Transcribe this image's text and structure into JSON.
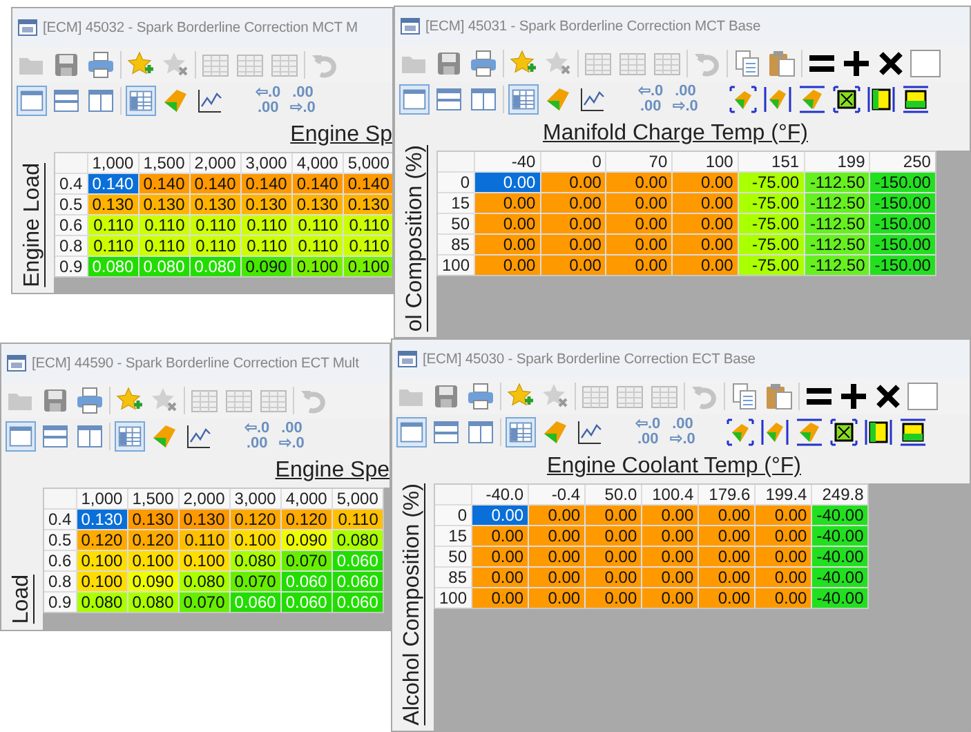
{
  "windows": [
    {
      "title": "[ECM] 45032 - Spark Borderline Correction MCT M",
      "clipped": true,
      "decimal_buttons": [
        {
          "lines": [
            "⇦.0",
            ".00"
          ]
        },
        {
          "lines": [
            ".00",
            "⇨.0"
          ]
        }
      ],
      "x_axis_label": "Engine Sp",
      "y_axis_label": "Engine Load",
      "table": {
        "columns": [
          "1,000",
          "1,500",
          "2,000",
          "3,000",
          "4,000",
          "5,000"
        ],
        "rows": [
          {
            "label": "0.4",
            "cells": [
              {
                "v": "0.140",
                "color": "#0a6fd8"
              },
              {
                "v": "0.140",
                "color": "#ff9900"
              },
              {
                "v": "0.140",
                "color": "#ff9900"
              },
              {
                "v": "0.140",
                "color": "#ff9900"
              },
              {
                "v": "0.140",
                "color": "#ff9900"
              },
              {
                "v": "0.140",
                "color": "#ff9900"
              }
            ]
          },
          {
            "label": "0.5",
            "cells": [
              {
                "v": "0.130",
                "color": "#ffb300"
              },
              {
                "v": "0.130",
                "color": "#ffb300"
              },
              {
                "v": "0.130",
                "color": "#ffb300"
              },
              {
                "v": "0.130",
                "color": "#ffb300"
              },
              {
                "v": "0.130",
                "color": "#ffb300"
              },
              {
                "v": "0.130",
                "color": "#ffb300"
              }
            ]
          },
          {
            "label": "0.6",
            "cells": [
              {
                "v": "0.110",
                "color": "#ccff00"
              },
              {
                "v": "0.110",
                "color": "#ccff00"
              },
              {
                "v": "0.110",
                "color": "#ccff00"
              },
              {
                "v": "0.110",
                "color": "#ccff00"
              },
              {
                "v": "0.110",
                "color": "#ccff00"
              },
              {
                "v": "0.110",
                "color": "#ccff00"
              }
            ]
          },
          {
            "label": "0.8",
            "cells": [
              {
                "v": "0.110",
                "color": "#ccff00"
              },
              {
                "v": "0.110",
                "color": "#ccff00"
              },
              {
                "v": "0.110",
                "color": "#ccff00"
              },
              {
                "v": "0.110",
                "color": "#ccff00"
              },
              {
                "v": "0.110",
                "color": "#ccff00"
              },
              {
                "v": "0.110",
                "color": "#ccff00"
              }
            ]
          },
          {
            "label": "0.9",
            "cells": [
              {
                "v": "0.080",
                "color": "#22dd00"
              },
              {
                "v": "0.080",
                "color": "#22dd00"
              },
              {
                "v": "0.080",
                "color": "#22dd00"
              },
              {
                "v": "0.090",
                "color": "#44e800"
              },
              {
                "v": "0.100",
                "color": "#77f000"
              },
              {
                "v": "0.100",
                "color": "#77f000"
              }
            ]
          }
        ]
      }
    },
    {
      "title": "[ECM] 45031 - Spark Borderline Correction MCT Base",
      "clipped": false,
      "decimal_buttons": [
        {
          "lines": [
            "⇦.0",
            ".00"
          ]
        },
        {
          "lines": [
            ".00",
            "⇨.0"
          ]
        }
      ],
      "x_axis_label": "Manifold Charge Temp (°F)",
      "y_axis_label": "ol Composition (%)",
      "table": {
        "columns": [
          "-40",
          "0",
          "70",
          "100",
          "151",
          "199",
          "250"
        ],
        "rows": [
          {
            "label": "0",
            "cells": [
              {
                "v": "0.00",
                "color": "#0a6fd8"
              },
              {
                "v": "0.00",
                "color": "#ff9900"
              },
              {
                "v": "0.00",
                "color": "#ff9900"
              },
              {
                "v": "0.00",
                "color": "#ff9900"
              },
              {
                "v": "-75.00",
                "color": "#aaff00"
              },
              {
                "v": "-112.50",
                "color": "#66f020"
              },
              {
                "v": "-150.00",
                "color": "#22e020"
              }
            ]
          },
          {
            "label": "15",
            "cells": [
              {
                "v": "0.00",
                "color": "#ff9900"
              },
              {
                "v": "0.00",
                "color": "#ff9900"
              },
              {
                "v": "0.00",
                "color": "#ff9900"
              },
              {
                "v": "0.00",
                "color": "#ff9900"
              },
              {
                "v": "-75.00",
                "color": "#aaff00"
              },
              {
                "v": "-112.50",
                "color": "#66f020"
              },
              {
                "v": "-150.00",
                "color": "#22e020"
              }
            ]
          },
          {
            "label": "50",
            "cells": [
              {
                "v": "0.00",
                "color": "#ff9900"
              },
              {
                "v": "0.00",
                "color": "#ff9900"
              },
              {
                "v": "0.00",
                "color": "#ff9900"
              },
              {
                "v": "0.00",
                "color": "#ff9900"
              },
              {
                "v": "-75.00",
                "color": "#aaff00"
              },
              {
                "v": "-112.50",
                "color": "#66f020"
              },
              {
                "v": "-150.00",
                "color": "#22e020"
              }
            ]
          },
          {
            "label": "85",
            "cells": [
              {
                "v": "0.00",
                "color": "#ff9900"
              },
              {
                "v": "0.00",
                "color": "#ff9900"
              },
              {
                "v": "0.00",
                "color": "#ff9900"
              },
              {
                "v": "0.00",
                "color": "#ff9900"
              },
              {
                "v": "-75.00",
                "color": "#aaff00"
              },
              {
                "v": "-112.50",
                "color": "#66f020"
              },
              {
                "v": "-150.00",
                "color": "#22e020"
              }
            ]
          },
          {
            "label": "100",
            "cells": [
              {
                "v": "0.00",
                "color": "#ff9900"
              },
              {
                "v": "0.00",
                "color": "#ff9900"
              },
              {
                "v": "0.00",
                "color": "#ff9900"
              },
              {
                "v": "0.00",
                "color": "#ff9900"
              },
              {
                "v": "-75.00",
                "color": "#aaff00"
              },
              {
                "v": "-112.50",
                "color": "#66f020"
              },
              {
                "v": "-150.00",
                "color": "#22e020"
              }
            ]
          }
        ]
      }
    },
    {
      "title": "[ECM] 44590 - Spark Borderline Correction ECT Mult",
      "clipped": true,
      "decimal_buttons": [
        {
          "lines": [
            "⇦.0",
            ".00"
          ]
        },
        {
          "lines": [
            ".00",
            "⇨.0"
          ]
        }
      ],
      "x_axis_label": "Engine Spe",
      "y_axis_label": "Load",
      "table": {
        "columns": [
          "1,000",
          "1,500",
          "2,000",
          "3,000",
          "4,000",
          "5,000"
        ],
        "rows": [
          {
            "label": "0.4",
            "cells": [
              {
                "v": "0.130",
                "color": "#0a6fd8"
              },
              {
                "v": "0.130",
                "color": "#ff9900"
              },
              {
                "v": "0.130",
                "color": "#ff9900"
              },
              {
                "v": "0.120",
                "color": "#ffaa00"
              },
              {
                "v": "0.120",
                "color": "#ffaa00"
              },
              {
                "v": "0.110",
                "color": "#ffc000"
              }
            ]
          },
          {
            "label": "0.5",
            "cells": [
              {
                "v": "0.120",
                "color": "#ffaa00"
              },
              {
                "v": "0.120",
                "color": "#ffaa00"
              },
              {
                "v": "0.110",
                "color": "#ffc000"
              },
              {
                "v": "0.100",
                "color": "#ffdd00"
              },
              {
                "v": "0.090",
                "color": "#eeff00"
              },
              {
                "v": "0.080",
                "color": "#aaff00"
              }
            ]
          },
          {
            "label": "0.6",
            "cells": [
              {
                "v": "0.100",
                "color": "#ffdd00"
              },
              {
                "v": "0.100",
                "color": "#ffdd00"
              },
              {
                "v": "0.100",
                "color": "#ffdd00"
              },
              {
                "v": "0.080",
                "color": "#aaff00"
              },
              {
                "v": "0.070",
                "color": "#66ee00"
              },
              {
                "v": "0.060",
                "color": "#22dd00"
              }
            ]
          },
          {
            "label": "0.8",
            "cells": [
              {
                "v": "0.100",
                "color": "#ffdd00"
              },
              {
                "v": "0.090",
                "color": "#eeff00"
              },
              {
                "v": "0.080",
                "color": "#aaff00"
              },
              {
                "v": "0.070",
                "color": "#66ee00"
              },
              {
                "v": "0.060",
                "color": "#22dd00"
              },
              {
                "v": "0.060",
                "color": "#22dd00"
              }
            ]
          },
          {
            "label": "0.9",
            "cells": [
              {
                "v": "0.080",
                "color": "#aaff00"
              },
              {
                "v": "0.080",
                "color": "#aaff00"
              },
              {
                "v": "0.070",
                "color": "#66ee00"
              },
              {
                "v": "0.060",
                "color": "#22dd00"
              },
              {
                "v": "0.060",
                "color": "#22dd00"
              },
              {
                "v": "0.060",
                "color": "#22dd00"
              }
            ]
          }
        ]
      }
    },
    {
      "title": "[ECM] 45030 - Spark Borderline Correction ECT Base",
      "clipped": false,
      "decimal_buttons": [
        {
          "lines": [
            "⇦.0",
            ".00"
          ]
        },
        {
          "lines": [
            ".00",
            "⇨.0"
          ]
        }
      ],
      "x_axis_label": "Engine Coolant Temp (°F)",
      "y_axis_label": "Alcohol Composition (%)",
      "table": {
        "columns": [
          "-40.0",
          "-0.4",
          "50.0",
          "100.4",
          "179.6",
          "199.4",
          "249.8"
        ],
        "rows": [
          {
            "label": "0",
            "cells": [
              {
                "v": "0.00",
                "color": "#0a6fd8"
              },
              {
                "v": "0.00",
                "color": "#ff9900"
              },
              {
                "v": "0.00",
                "color": "#ff9900"
              },
              {
                "v": "0.00",
                "color": "#ff9900"
              },
              {
                "v": "0.00",
                "color": "#ff9900"
              },
              {
                "v": "0.00",
                "color": "#ff9900"
              },
              {
                "v": "-40.00",
                "color": "#22e020"
              }
            ]
          },
          {
            "label": "15",
            "cells": [
              {
                "v": "0.00",
                "color": "#ff9900"
              },
              {
                "v": "0.00",
                "color": "#ff9900"
              },
              {
                "v": "0.00",
                "color": "#ff9900"
              },
              {
                "v": "0.00",
                "color": "#ff9900"
              },
              {
                "v": "0.00",
                "color": "#ff9900"
              },
              {
                "v": "0.00",
                "color": "#ff9900"
              },
              {
                "v": "-40.00",
                "color": "#22e020"
              }
            ]
          },
          {
            "label": "50",
            "cells": [
              {
                "v": "0.00",
                "color": "#ff9900"
              },
              {
                "v": "0.00",
                "color": "#ff9900"
              },
              {
                "v": "0.00",
                "color": "#ff9900"
              },
              {
                "v": "0.00",
                "color": "#ff9900"
              },
              {
                "v": "0.00",
                "color": "#ff9900"
              },
              {
                "v": "0.00",
                "color": "#ff9900"
              },
              {
                "v": "-40.00",
                "color": "#22e020"
              }
            ]
          },
          {
            "label": "85",
            "cells": [
              {
                "v": "0.00",
                "color": "#ff9900"
              },
              {
                "v": "0.00",
                "color": "#ff9900"
              },
              {
                "v": "0.00",
                "color": "#ff9900"
              },
              {
                "v": "0.00",
                "color": "#ff9900"
              },
              {
                "v": "0.00",
                "color": "#ff9900"
              },
              {
                "v": "0.00",
                "color": "#ff9900"
              },
              {
                "v": "-40.00",
                "color": "#22e020"
              }
            ]
          },
          {
            "label": "100",
            "cells": [
              {
                "v": "0.00",
                "color": "#ff9900"
              },
              {
                "v": "0.00",
                "color": "#ff9900"
              },
              {
                "v": "0.00",
                "color": "#ff9900"
              },
              {
                "v": "0.00",
                "color": "#ff9900"
              },
              {
                "v": "0.00",
                "color": "#ff9900"
              },
              {
                "v": "0.00",
                "color": "#ff9900"
              },
              {
                "v": "-40.00",
                "color": "#22e020"
              }
            ]
          }
        ]
      }
    }
  ]
}
